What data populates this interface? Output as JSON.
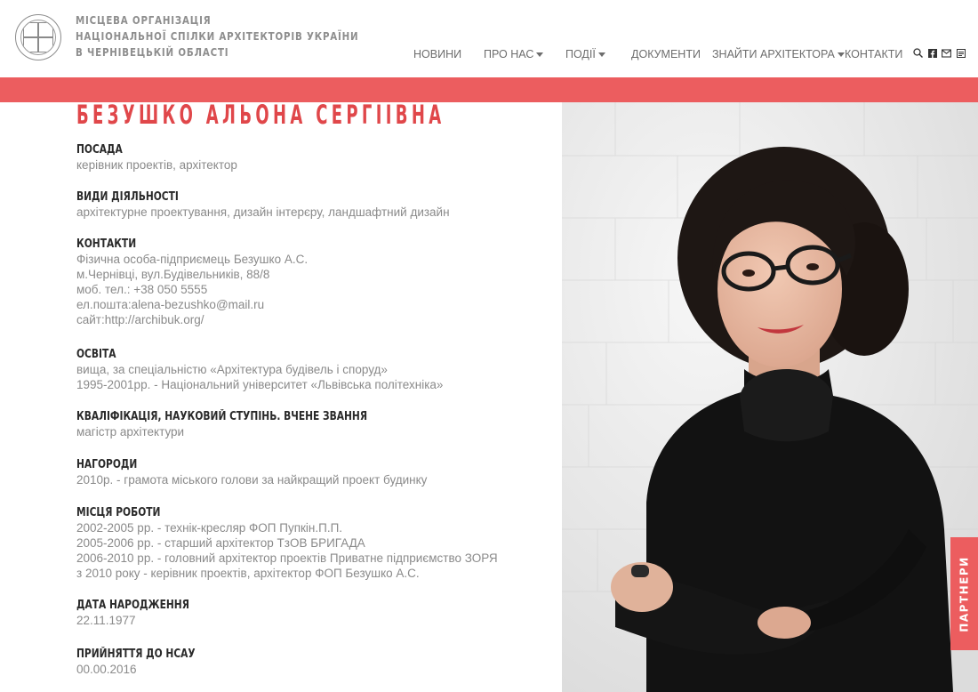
{
  "org": {
    "line1": "МІСЦЕВА ОРГАНІЗАЦІЯ",
    "line2": "НАЦІОНАЛЬНОЇ СПІЛКИ АРХІТЕКТОРІВ УКРАЇНИ",
    "line3": "В ЧЕРНІВЕЦЬКІЙ ОБЛАСТІ"
  },
  "nav": {
    "news": "НОВИНИ",
    "about": "ПРО НАС",
    "events": "ПОДІЇ",
    "documents": "ДОКУМЕНТИ",
    "find": "ЗНАЙТИ АРХІТЕКТОРА",
    "contacts": "КОНТАКТИ"
  },
  "header_icons": [
    "search-icon",
    "facebook-icon",
    "mail-icon",
    "profile-icon"
  ],
  "colors": {
    "accent": "#ec5d5f",
    "name": "#e0474a",
    "text": "#8a8a8a",
    "heading": "#2a2a2a"
  },
  "profile": {
    "name": "БЕЗУШКО АЛЬОНА СЕРГІІВНА",
    "sections": {
      "position": {
        "title": "ПОСАДА",
        "lines": [
          "керівник проектів, архітектор"
        ]
      },
      "activities": {
        "title": "ВИДИ ДІЯЛЬНОСТІ",
        "lines": [
          "архітектурне проектування, дизайн інтерєру, ландшафтний дизайн"
        ]
      },
      "contacts": {
        "title": "КОНТАКТИ",
        "lines": [
          "Фізична особа-підприємець Безушко А.С.",
          "м.Чернівці, вул.Будівельників, 88/8",
          "моб. тел.:  +38 050 5555",
          "ел.пошта:alena-bezushko@mail.ru",
          "сайт:http://archibuk.org/"
        ]
      },
      "education": {
        "title": "ОСВІТА",
        "lines": [
          "вища, за спеціальністю «Архітектура будівель і споруд»",
          "1995-2001рр. - Національний університет «Львівська політехніка»"
        ]
      },
      "qualification": {
        "title": "КВАЛІФІКАЦІЯ, НАУКОВИЙ СТУПІНЬ. ВЧЕНЕ ЗВАННЯ",
        "lines": [
          "магістр архітектури"
        ]
      },
      "awards": {
        "title": "НАГОРОДИ",
        "lines": [
          "2010р. - грамота міського голови за найкращий проект будинку"
        ]
      },
      "work": {
        "title": "МІСЦЯ РОБОТИ",
        "lines": [
          "2002-2005 рр. - технік-кресляр ФОП Пупкін.П.П.",
          "2005-2006 рр. - старший архітектор ТзОВ БРИГАДА",
          "2006-2010 рр. - головний архітектор проектів Приватне підприємство ЗОРЯ",
          "з 2010 року  - керівник проектів, архітектор ФОП Безушко А.С."
        ]
      },
      "birth": {
        "title": "ДАТА НАРОДЖЕННЯ",
        "lines": [
          "22.11.1977"
        ]
      },
      "admission": {
        "title": "ПРИЙНЯТТЯ ДО НСАУ",
        "lines": [
          "00.00.2016"
        ]
      }
    }
  },
  "partners_tab": "ПАРТНЕРИ"
}
